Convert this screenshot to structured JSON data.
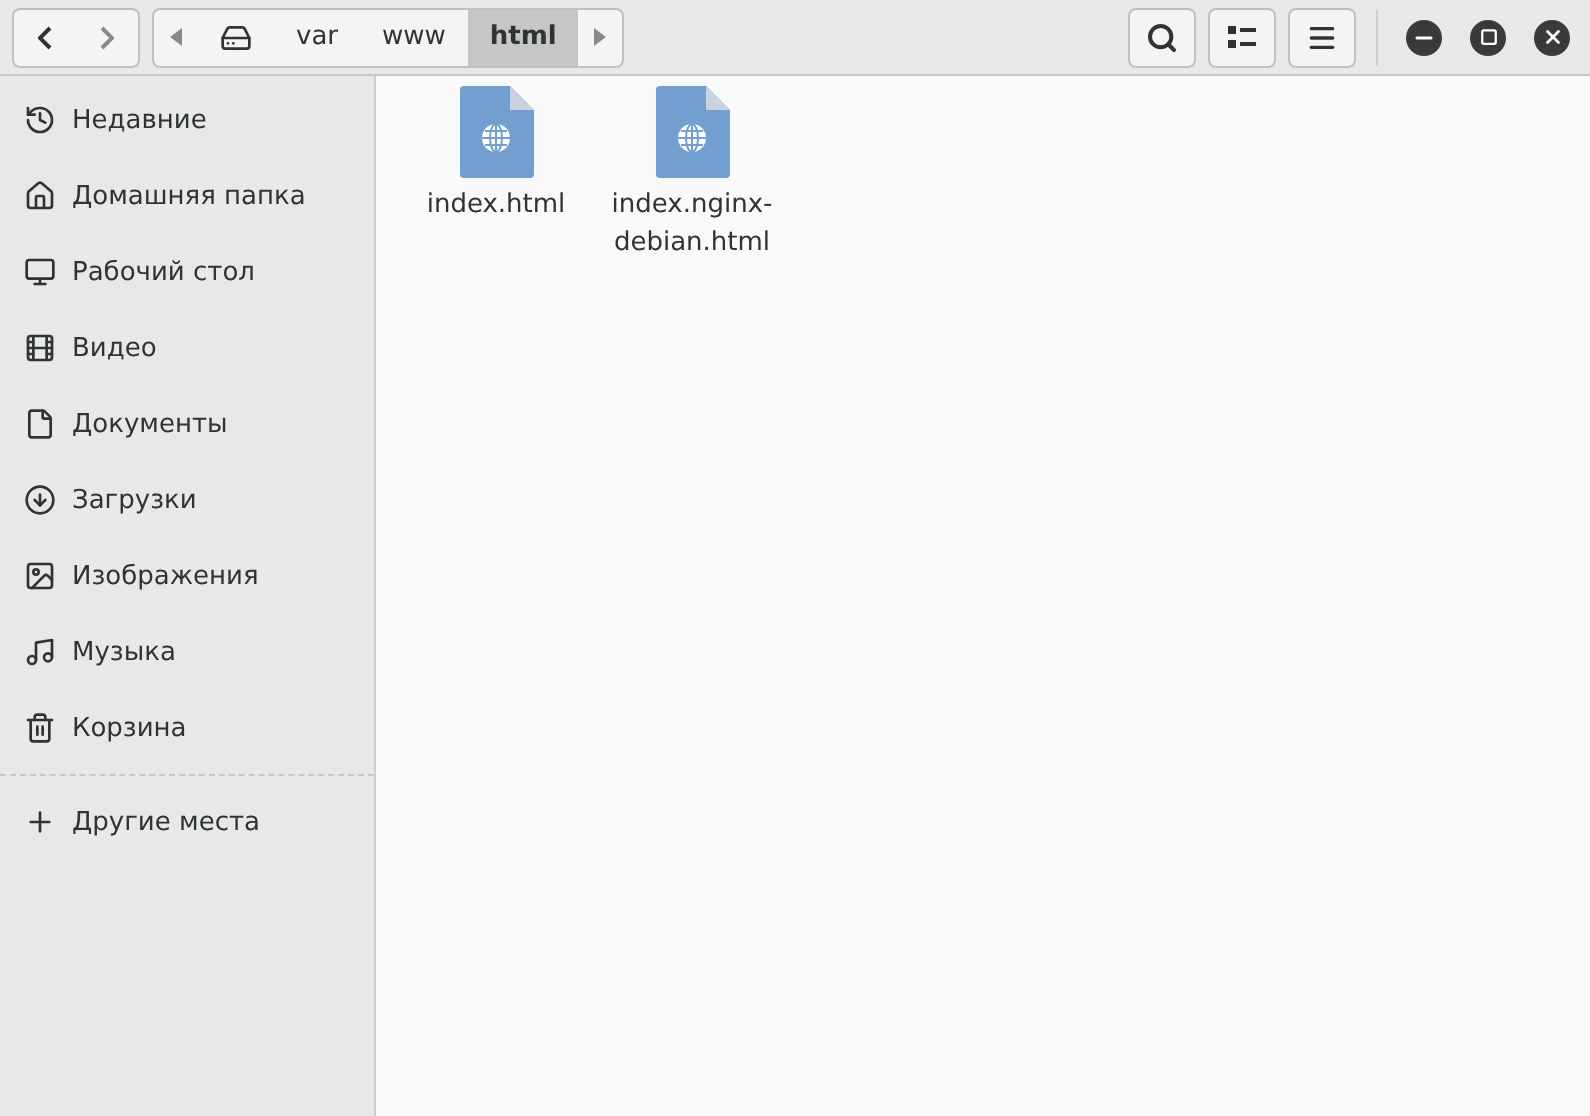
{
  "path": [
    {
      "kind": "disk",
      "selected": false
    },
    {
      "kind": "folder",
      "label": "var",
      "selected": false
    },
    {
      "kind": "folder",
      "label": "www",
      "selected": false
    },
    {
      "kind": "folder",
      "label": "html",
      "selected": true
    }
  ],
  "sidebar": {
    "items": [
      {
        "kind": "recent",
        "label": "Недавние"
      },
      {
        "kind": "home",
        "label": "Домашняя папка"
      },
      {
        "kind": "desktop",
        "label": "Рабочий стол"
      },
      {
        "kind": "video",
        "label": "Видео"
      },
      {
        "kind": "documents",
        "label": "Документы"
      },
      {
        "kind": "downloads",
        "label": "Загрузки"
      },
      {
        "kind": "pictures",
        "label": "Изображения"
      },
      {
        "kind": "music",
        "label": "Музыка"
      },
      {
        "kind": "trash",
        "label": "Корзина"
      }
    ],
    "other": {
      "label": "Другие места"
    }
  },
  "files": [
    {
      "name": "index.html"
    },
    {
      "name": "index.nginx-debian.html"
    }
  ]
}
